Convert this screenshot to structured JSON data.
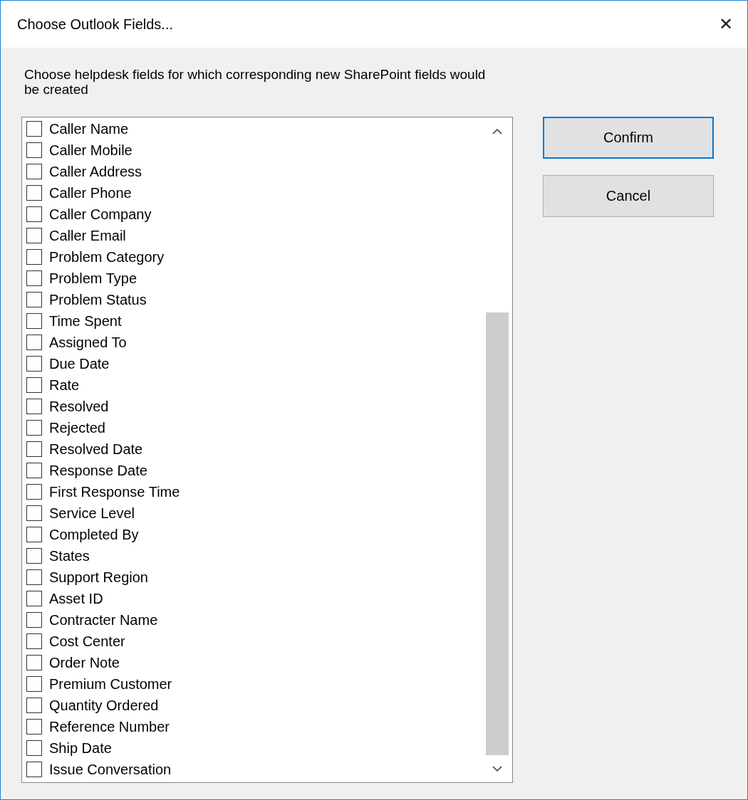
{
  "window": {
    "title": "Choose Outlook Fields...",
    "close": "✕"
  },
  "description": "Choose helpdesk fields for which corresponding new SharePoint fields would be created",
  "fields": [
    {
      "label": "Caller Name",
      "checked": false
    },
    {
      "label": "Caller Mobile",
      "checked": false
    },
    {
      "label": "Caller Address",
      "checked": false
    },
    {
      "label": "Caller Phone",
      "checked": false
    },
    {
      "label": "Caller Company",
      "checked": false
    },
    {
      "label": "Caller Email",
      "checked": false
    },
    {
      "label": "Problem Category",
      "checked": false
    },
    {
      "label": "Problem Type",
      "checked": false
    },
    {
      "label": "Problem Status",
      "checked": false
    },
    {
      "label": "Time Spent",
      "checked": false
    },
    {
      "label": "Assigned To",
      "checked": false
    },
    {
      "label": "Due Date",
      "checked": false
    },
    {
      "label": "Rate",
      "checked": false
    },
    {
      "label": "Resolved",
      "checked": false
    },
    {
      "label": "Rejected",
      "checked": false
    },
    {
      "label": "Resolved Date",
      "checked": false
    },
    {
      "label": "Response Date",
      "checked": false
    },
    {
      "label": "First Response Time",
      "checked": false
    },
    {
      "label": "Service Level",
      "checked": false
    },
    {
      "label": "Completed By",
      "checked": false
    },
    {
      "label": "States",
      "checked": false
    },
    {
      "label": "Support Region",
      "checked": false
    },
    {
      "label": "Asset ID",
      "checked": false
    },
    {
      "label": "Contracter Name",
      "checked": false
    },
    {
      "label": "Cost Center",
      "checked": false
    },
    {
      "label": "Order Note",
      "checked": false
    },
    {
      "label": "Premium Customer",
      "checked": false
    },
    {
      "label": "Quantity Ordered",
      "checked": false
    },
    {
      "label": "Reference Number",
      "checked": false
    },
    {
      "label": "Ship Date",
      "checked": false
    },
    {
      "label": "Issue Conversation",
      "checked": false
    }
  ],
  "buttons": [
    {
      "label": "Confirm",
      "selected": true
    },
    {
      "label": "Cancel",
      "selected": false
    }
  ]
}
